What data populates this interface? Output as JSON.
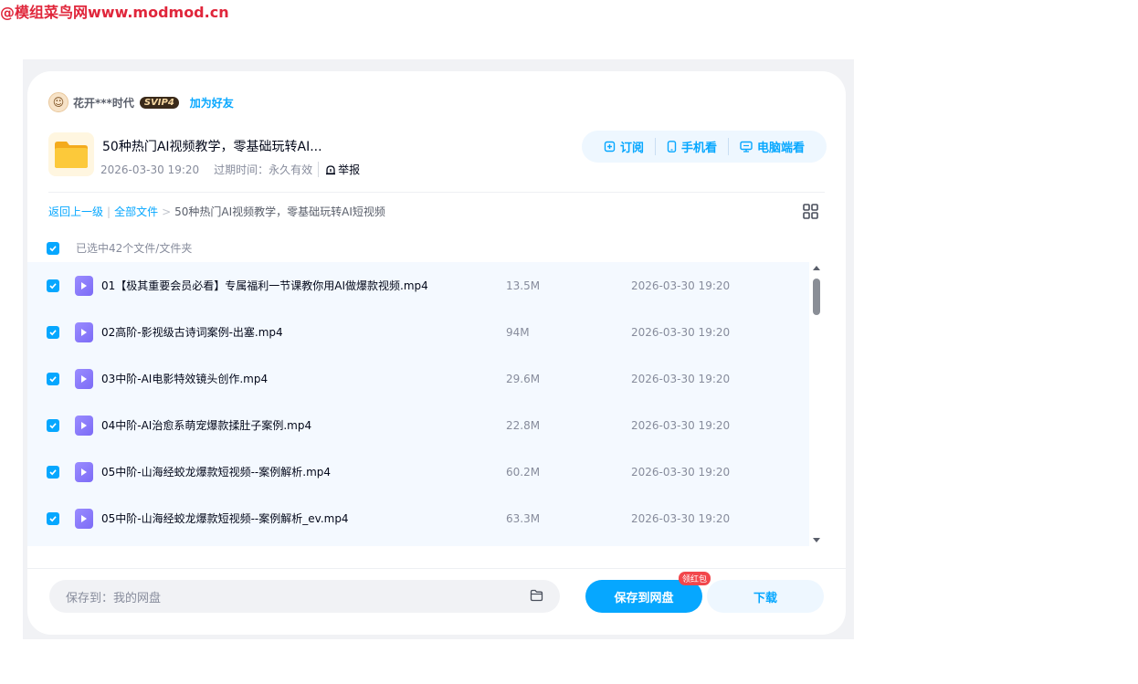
{
  "watermark": "@模组菜鸟网www.modmod.cn",
  "user": {
    "name": "花开***时代",
    "vip": "SVIP4",
    "add_friend": "加为好友"
  },
  "share": {
    "title": "50种热门AI视频教学，零基础玩转AI...",
    "created": "2026-03-30 19:20",
    "expire_label": "过期时间：",
    "expire_value": "永久有效",
    "report": "举报"
  },
  "actions": {
    "subscribe": "订阅",
    "mobile": "手机看",
    "desktop": "电脑端看"
  },
  "breadcrumb": {
    "back": "返回上一级",
    "all": "全部文件",
    "sep": ">",
    "current": "50种热门AI视频教学，零基础玩转AI短视频"
  },
  "selection": {
    "label": "已选中42个文件/文件夹"
  },
  "files": [
    {
      "name": "01【极其重要会员必看】专属福利一节课教你用AI做爆款视频.mp4",
      "size": "13.5M",
      "date": "2026-03-30 19:20"
    },
    {
      "name": "02高阶-影视级古诗词案例-出塞.mp4",
      "size": "94M",
      "date": "2026-03-30 19:20"
    },
    {
      "name": "03中阶-AI电影特效镜头创作.mp4",
      "size": "29.6M",
      "date": "2026-03-30 19:20"
    },
    {
      "name": "04中阶-AI治愈系萌宠爆款揉肚子案例.mp4",
      "size": "22.8M",
      "date": "2026-03-30 19:20"
    },
    {
      "name": "05中阶-山海经蛟龙爆款短视频--案例解析.mp4",
      "size": "60.2M",
      "date": "2026-03-30 19:20"
    },
    {
      "name": "05中阶-山海经蛟龙爆款短视频--案例解析_ev.mp4",
      "size": "63.3M",
      "date": "2026-03-30 19:20"
    }
  ],
  "footer": {
    "save_to_label": "保存到：",
    "save_to_value": "我的网盘",
    "save_button": "保存到网盘",
    "badge": "领红包",
    "download_button": "下载"
  },
  "colors": {
    "accent": "#06a7ff",
    "badge": "#f2474c",
    "video_icon": "#8a7cf8",
    "folder": "#f8c130"
  }
}
